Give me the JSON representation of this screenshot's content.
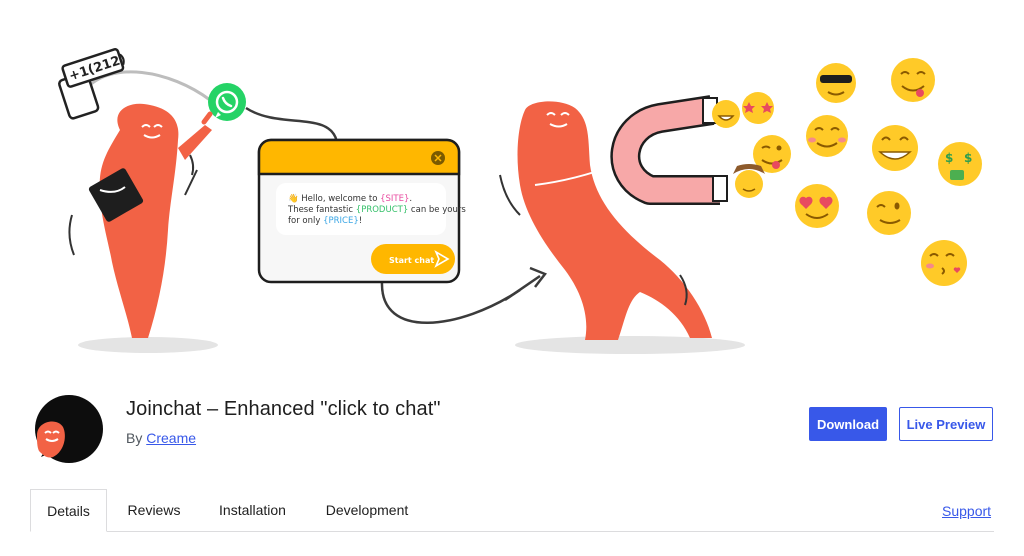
{
  "banner": {
    "phone_label": "+1(212)",
    "chat_greeting": "👋 Hello, welcome to ",
    "chat_site": "{SITE}",
    "chat_line2a": "These fantastic ",
    "chat_product": "{PRODUCT}",
    "chat_line2b": " can be yours",
    "chat_line3a": "for only ",
    "chat_price": "{PRICE}",
    "chat_line3b": "!",
    "start_chat_label": "Start chat",
    "close_icon": "close-icon",
    "send_icon": "send-icon",
    "whatsapp_icon": "whatsapp-icon",
    "emoji_list": [
      "sunglasses-emoji",
      "yum-emoji",
      "grin-emoji",
      "star-struck-emoji",
      "winking-tongue-emoji",
      "blush-emoji",
      "beaming-emoji",
      "money-mouth-emoji",
      "cowboy-emoji",
      "heart-eyes-emoji",
      "wink-emoji",
      "kissing-emoji"
    ]
  },
  "plugin": {
    "title": "Joinchat – Enhanced \"click to chat\"",
    "author_prefix": "By ",
    "author_name": "Creame",
    "icon": "joinchat-logo-icon"
  },
  "actions": {
    "download_label": "Download",
    "preview_label": "Live Preview"
  },
  "tabs": [
    {
      "label": "Details",
      "active": true
    },
    {
      "label": "Reviews",
      "active": false
    },
    {
      "label": "Installation",
      "active": false
    },
    {
      "label": "Development",
      "active": false
    }
  ],
  "support_label": "Support",
  "colors": {
    "accent": "#3858e9",
    "character": "#f26245",
    "chat_header": "#ffb700",
    "whatsapp": "#25d366"
  }
}
